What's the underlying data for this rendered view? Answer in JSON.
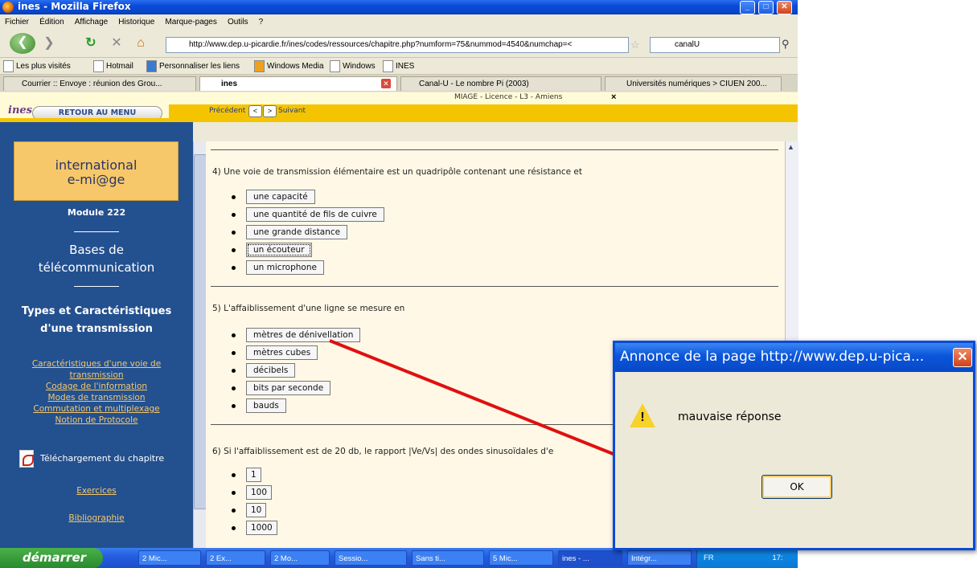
{
  "window": {
    "title": "ines - Mozilla Firefox"
  },
  "menubar": [
    "Fichier",
    "Édition",
    "Affichage",
    "Historique",
    "Marque-pages",
    "Outils",
    "?"
  ],
  "nav": {
    "url": "http://www.dep.u-picardie.fr/ines/codes/ressources/chapitre.php?numform=75&nummod=4540&numchap=<",
    "search_value": "canalU"
  },
  "bookmarks": [
    "Les plus visités",
    "Hotmail",
    "Personnaliser les liens",
    "Windows Media",
    "Windows",
    "INES"
  ],
  "tabs": [
    "Courrier :: Envoye : réunion des Grou...",
    "ines",
    "Canal-U - Le nombre Pi (2003)",
    "Universités numériques > CIUEN 200..."
  ],
  "app": {
    "header_title": "MIAGE - Licence - L3 - Amiens",
    "header_close": "×",
    "logo": "ines",
    "retour_button": "RETOUR AU MENU",
    "prev_label": "Précédent",
    "next_label": "Suivant"
  },
  "sidebar": {
    "brand_line1": "international",
    "brand_line2": "e-mi@ge",
    "module": "Module 222",
    "title_line1": "Bases de",
    "title_line2": "télécommunication",
    "chapter_line1": "Types et Caractéristiques",
    "chapter_line2": "d'une transmission",
    "links": [
      "Caractéristiques d'une voie de",
      "transmission",
      "Codage de l'information",
      "Modes de transmission",
      "Commutation et multiplexage",
      "Notion de Protocole"
    ],
    "download": "Téléchargement du chapitre",
    "exercices": "Exercices",
    "bibliographie": "Bibliographie"
  },
  "questions": [
    {
      "text": "4) Une voie de transmission élémentaire est un quadripôle contenant une résistance et",
      "options": [
        "une capacité",
        "une quantité de fils de cuivre",
        "une grande distance",
        "un écouteur",
        "un microphone"
      ]
    },
    {
      "text": "5) L'affaiblissement d'une ligne se mesure en",
      "options": [
        "mètres de dénivellation",
        "mètres cubes",
        "décibels",
        "bits par seconde",
        "bauds"
      ]
    },
    {
      "text": "6) Si l'affaiblissement est de 20 db, le rapport |Ve/Vs| des ondes sinusoïdales d'e",
      "options": [
        "1",
        "100",
        "10",
        "1000"
      ]
    }
  ],
  "taskbar": {
    "start": "démarrer",
    "tasks": [
      "2 Mic...",
      "2 Ex...",
      "2 Mo...",
      "Sessio...",
      "Sans ti...",
      "5 Mic...",
      "ines - ...",
      "Intégr..."
    ],
    "tray": "FR",
    "clock": "17:"
  },
  "dialog": {
    "title": "Annonce de la page  http://www.dep.u-pica...",
    "message": "mauvaise réponse",
    "ok": "OK"
  }
}
